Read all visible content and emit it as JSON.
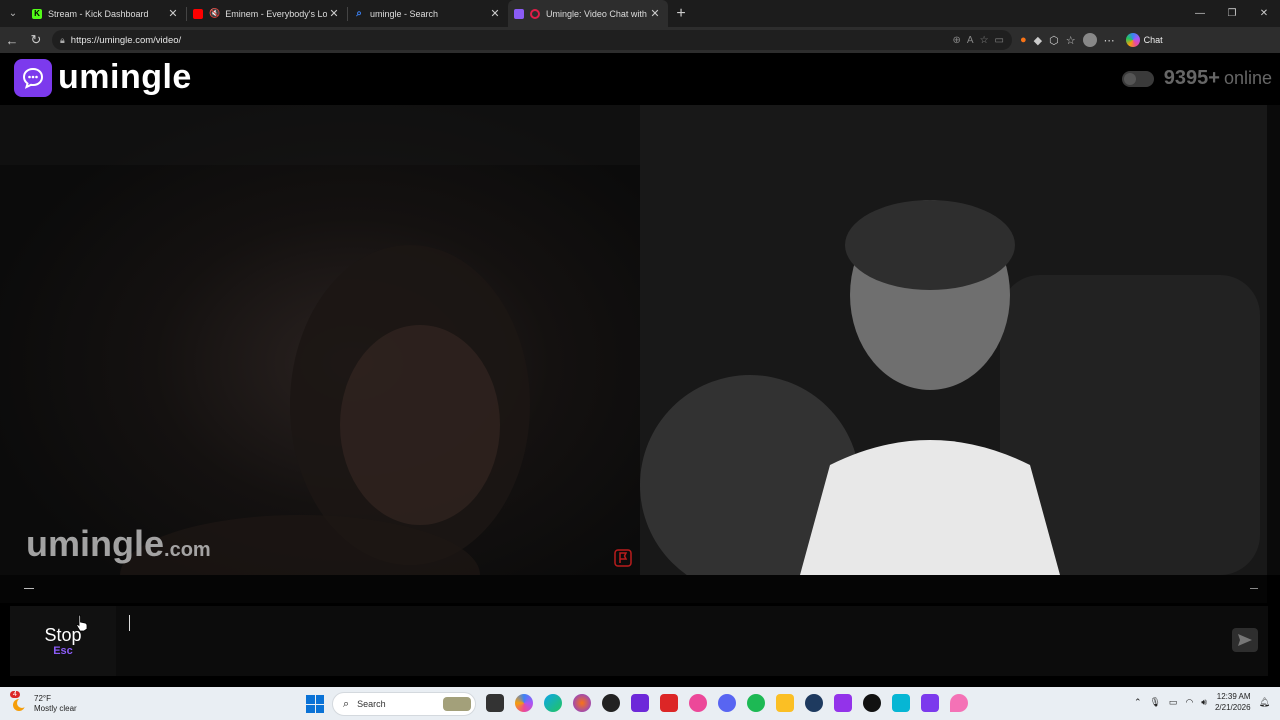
{
  "browser": {
    "tabs": [
      {
        "title": "Stream - Kick Dashboard",
        "favicon_color": "#53fc18",
        "favicon_glyph": "K",
        "active": false
      },
      {
        "title": "Eminem - Everybody's Lookin",
        "favicon_color": "#ff0000",
        "favicon_glyph": "",
        "active": false,
        "muted": true
      },
      {
        "title": "umingle - Search",
        "favicon_color": "#3b82f6",
        "favicon_glyph": "",
        "active": false
      },
      {
        "title": "Umingle: Video Chat with Str",
        "favicon_color": "#8b5cf6",
        "favicon_glyph": "",
        "active": true
      }
    ],
    "url": "https://umingle.com/video/",
    "chat_label": "Chat"
  },
  "page": {
    "logo_text": "umingle",
    "online_count": "9395",
    "online_plus": "+",
    "online_label": "online",
    "watermark_main": "umingle",
    "watermark_domain": ".com",
    "stop_label": "Stop",
    "stop_shortcut": "Esc",
    "accent_color": "#7c3aed"
  },
  "taskbar": {
    "weather_temp": "72°F",
    "weather_desc": "Mostly clear",
    "weather_badge": "4",
    "search_label": "Search",
    "time": "12:39 AM",
    "date": "2/21/2026"
  }
}
